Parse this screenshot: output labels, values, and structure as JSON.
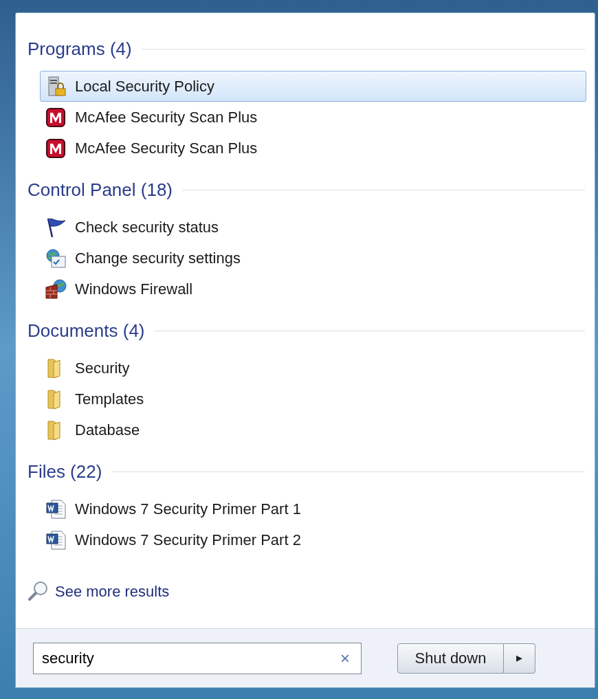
{
  "groups": [
    {
      "title": "Programs (4)",
      "items": [
        {
          "label": "Local Security Policy",
          "kind": "policy",
          "selected": true
        },
        {
          "label": "McAfee Security Scan Plus",
          "kind": "mcafee",
          "selected": false
        },
        {
          "label": "McAfee Security Scan Plus",
          "kind": "mcafee",
          "selected": false
        }
      ]
    },
    {
      "title": "Control Panel (18)",
      "items": [
        {
          "label": "Check security status",
          "kind": "flag",
          "selected": false
        },
        {
          "label": "Change security settings",
          "kind": "settings",
          "selected": false
        },
        {
          "label": "Windows Firewall",
          "kind": "firewall",
          "selected": false
        }
      ]
    },
    {
      "title": "Documents (4)",
      "items": [
        {
          "label": "Security",
          "kind": "folder",
          "selected": false
        },
        {
          "label": "Templates",
          "kind": "folder",
          "selected": false
        },
        {
          "label": "Database",
          "kind": "folder",
          "selected": false
        }
      ]
    },
    {
      "title": "Files (22)",
      "items": [
        {
          "label": "Windows 7 Security Primer Part 1",
          "kind": "word",
          "selected": false
        },
        {
          "label": "Windows 7 Security Primer Part 2",
          "kind": "word",
          "selected": false
        }
      ]
    }
  ],
  "see_more": "See more results",
  "search": {
    "value": "security",
    "clear": "×"
  },
  "shutdown": {
    "label": "Shut down",
    "arrow": "▸"
  }
}
